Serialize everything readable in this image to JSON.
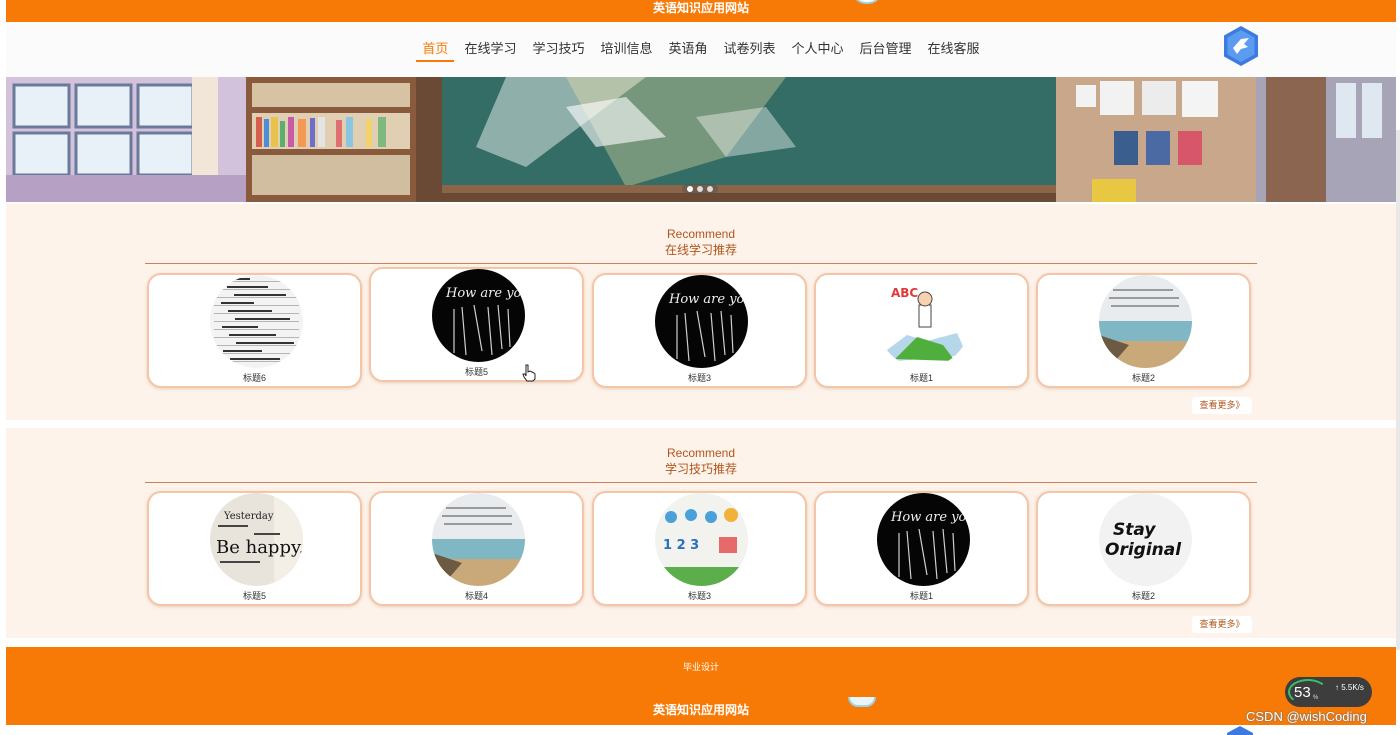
{
  "site": {
    "title": "英语知识应用网站"
  },
  "nav": {
    "items": [
      {
        "label": "首页",
        "active": true
      },
      {
        "label": "在线学习",
        "active": false
      },
      {
        "label": "学习技巧",
        "active": false
      },
      {
        "label": "培训信息",
        "active": false
      },
      {
        "label": "英语角",
        "active": false
      },
      {
        "label": "试卷列表",
        "active": false
      },
      {
        "label": "个人中心",
        "active": false
      },
      {
        "label": "后台管理",
        "active": false
      },
      {
        "label": "在线客服",
        "active": false
      }
    ]
  },
  "sections": [
    {
      "kicker": "Recommend",
      "title": "在线学习推荐",
      "more": "查看更多》",
      "cards": [
        {
          "label": "标题6",
          "image": "lined-text"
        },
        {
          "label": "标题5",
          "image": "how-are-you"
        },
        {
          "label": "标题3",
          "image": "how-are-you"
        },
        {
          "label": "标题1",
          "image": "abc-kid"
        },
        {
          "label": "标题2",
          "image": "beach"
        }
      ]
    },
    {
      "kicker": "Recommend",
      "title": "学习技巧推荐",
      "more": "查看更多》",
      "cards": [
        {
          "label": "标题5",
          "image": "be-happy"
        },
        {
          "label": "标题4",
          "image": "beach"
        },
        {
          "label": "标题3",
          "image": "weather-wall"
        },
        {
          "label": "标题1",
          "image": "how-are-you"
        },
        {
          "label": "标题2",
          "image": "stay-original"
        }
      ]
    }
  ],
  "footer": {
    "small": "毕业设计",
    "name": "英语知识应用网站"
  },
  "overlay": {
    "speed_value": "53",
    "speed_unit": "%",
    "net": "↑ 5.5K/s",
    "watermark": "CSDN @wishCoding"
  },
  "colors": {
    "primary": "#f77a07",
    "section_bg": "#fdf3ea",
    "title": "#b1551b",
    "card_border": "#f3c6a9"
  }
}
